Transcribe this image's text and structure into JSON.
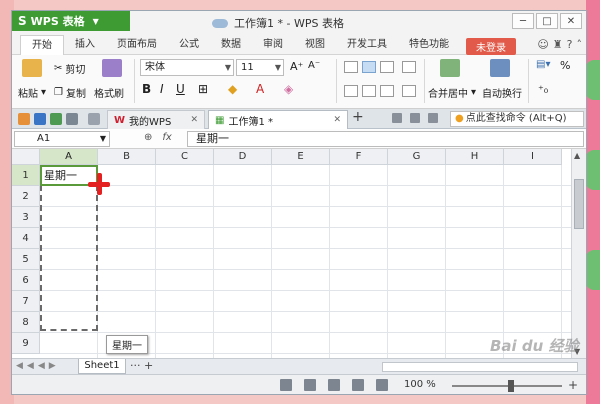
{
  "app": {
    "name": "WPS 表格",
    "title": "工作簿1 * - WPS 表格"
  },
  "menu": {
    "items": [
      "开始",
      "插入",
      "页面布局",
      "公式",
      "数据",
      "审阅",
      "视图",
      "开发工具",
      "特色功能"
    ],
    "active": "开始",
    "login_label": "未登录"
  },
  "ribbon": {
    "paste": "粘贴",
    "cut": "剪切",
    "copy": "复制",
    "format_painter": "格式刷",
    "font_name": "宋体",
    "font_size": "11",
    "merge_center": "合并居中",
    "auto_wrap": "自动换行"
  },
  "tabs": {
    "my_wps": "我的WPS",
    "workbook": "工作簿1 *",
    "search_command": "点此查找命令 (Alt+Q)"
  },
  "formula_bar": {
    "cell_ref": "A1",
    "fx": "fx",
    "content": "星期一"
  },
  "sheet": {
    "columns": [
      "A",
      "B",
      "C",
      "D",
      "E",
      "F",
      "G",
      "H",
      "I"
    ],
    "rows": [
      "1",
      "2",
      "3",
      "4",
      "5",
      "6",
      "7",
      "8",
      "9"
    ],
    "cell_a1": "星期一",
    "fill_tooltip": "星期一",
    "tab_name": "Sheet1"
  },
  "status": {
    "zoom": "100 %"
  },
  "watermark": "Bai du 经验",
  "colors": {
    "app_green": "#3e9b34",
    "selection_green": "#5a9a3a",
    "login_red": "#e25b4a",
    "cursor_red": "#e42020"
  }
}
